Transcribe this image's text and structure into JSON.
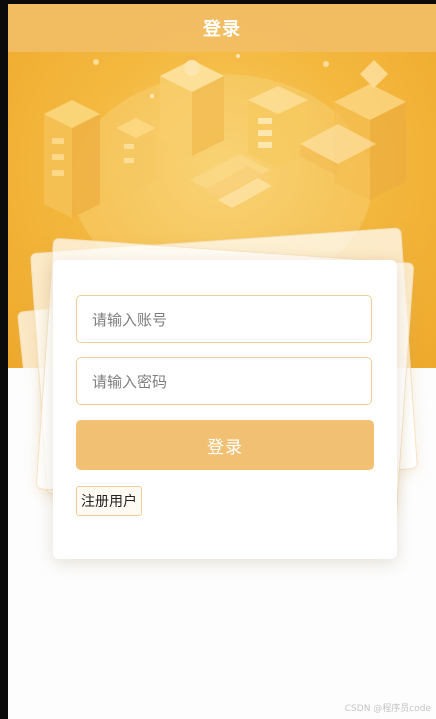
{
  "header": {
    "title": "登录"
  },
  "illustration": {
    "name": "isometric-office-illustration"
  },
  "login_form": {
    "account_placeholder": "请输入账号",
    "password_placeholder": "请输入密码",
    "login_label": "登录",
    "register_label": "注册用户"
  },
  "footer": {
    "watermark": "CSDN @程序员code"
  },
  "colors": {
    "accent": "#f1c072",
    "hero": "#f4b940",
    "header": "#f2bd65",
    "input_border": "#f0cf94"
  }
}
